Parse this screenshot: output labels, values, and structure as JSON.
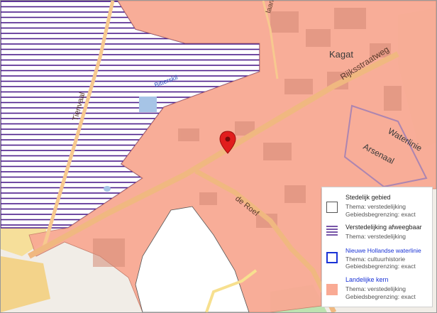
{
  "map": {
    "streets": [
      {
        "id": "rijksstraatweg",
        "name": "Rijksstraatweg"
      },
      {
        "id": "de-roef",
        "name": "de Roef"
      },
      {
        "id": "tienvaal",
        "name": "Tienvaal"
      },
      {
        "id": "bitterskil",
        "name": "Bitterskil"
      },
      {
        "id": "top-street",
        "name": "laan"
      }
    ],
    "places": [
      {
        "id": "kagat",
        "name": "Kagat"
      },
      {
        "id": "waterlinie",
        "name": "Waterlinie"
      },
      {
        "id": "arsenaal",
        "name": "Arsenaal"
      }
    ],
    "marker": {
      "icon": "map-pin-icon",
      "color": "#e11d1d"
    }
  },
  "legend": {
    "items": [
      {
        "id": "stedelijk",
        "title": "Stedelijk gebied",
        "lines": [
          "Thema: verstedelijking",
          "Gebiedsbegrenzing: exact"
        ],
        "swatch": "outline-gray",
        "title_color": "#222222"
      },
      {
        "id": "verstedelijking",
        "title": "Verstedelijking afweegbaar",
        "lines": [
          "Thema: verstedelijking"
        ],
        "swatch": "hatch-purple",
        "title_color": "#222222"
      },
      {
        "id": "waterlinie",
        "title": "Nieuwe Hollandse waterlinie",
        "lines": [
          "Thema: cultuurhistorie",
          "Gebiedsbegrenzing: exact"
        ],
        "swatch": "outline-blue",
        "title_color": "#1a33d6"
      },
      {
        "id": "landelijke",
        "title": "Landelijke kern",
        "lines": [
          "Thema: verstedelijking",
          "Gebiedsbegrenzing: exact"
        ],
        "swatch": "fill-salmon",
        "title_color": "#1a33d6"
      }
    ]
  },
  "colors": {
    "salmon": "#f9aa94",
    "hatch": "#4b1d8a",
    "road": "#f7c98f",
    "water": "#b7d3ee",
    "wood": "#c7e0b4"
  }
}
